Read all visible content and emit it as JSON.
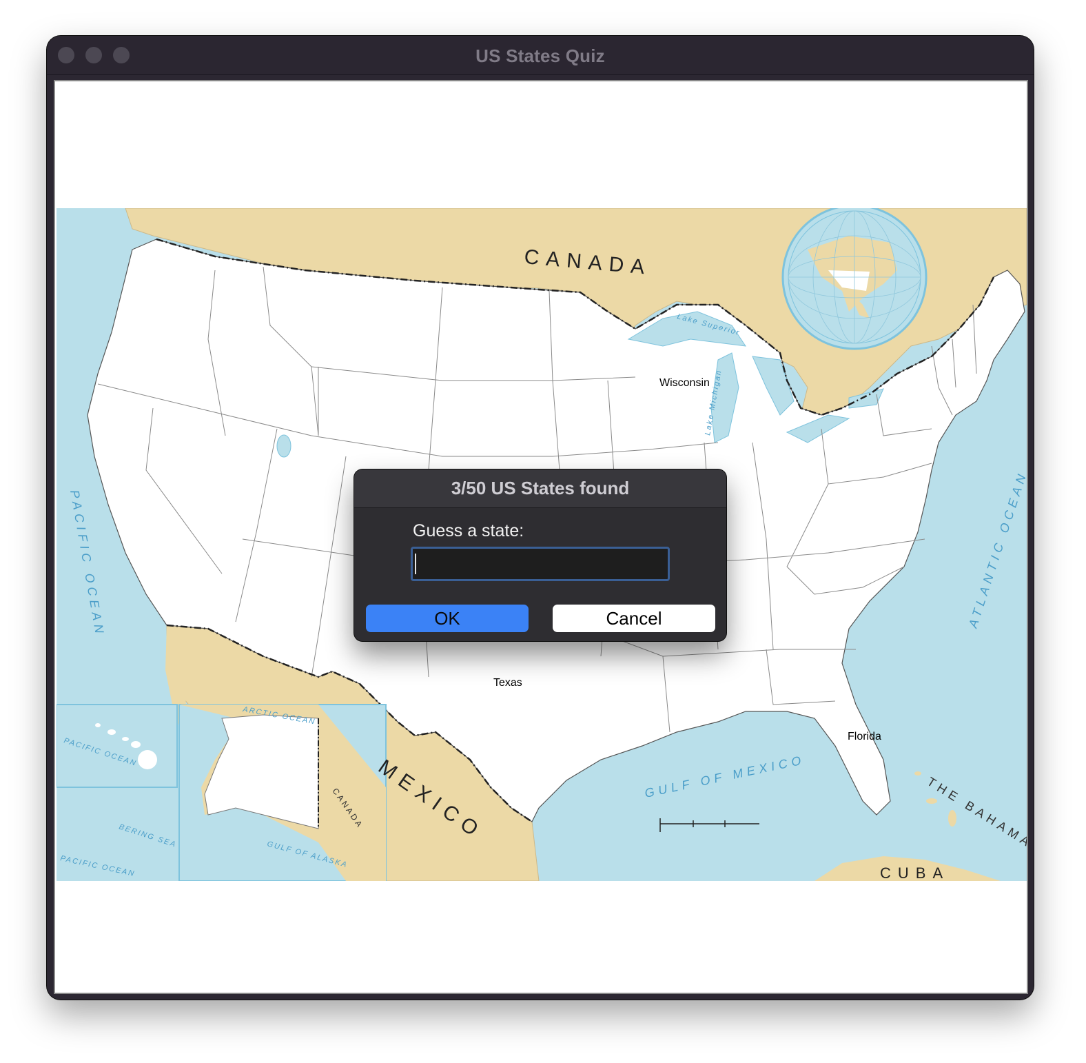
{
  "window": {
    "title": "US States Quiz"
  },
  "map": {
    "labels": {
      "canada": "CANADA",
      "canada_inset": "CANADA",
      "mexico": "MEXICO",
      "pacific": "PACIFIC OCEAN",
      "atlantic": "ATLANTIC OCEAN",
      "gulf": "GULF OF MEXICO",
      "bahamas": "THE BAHAMAS",
      "cuba": "CUBA",
      "arctic": "ARCTIC OCEAN",
      "bering": "BERING SEA",
      "gulf_alaska": "GULF OF ALASKA",
      "pacific_inset": "PACIFIC OCEAN",
      "pacific_alaska": "PACIFIC OCEAN",
      "lake_superior": "Lake Superior",
      "lake_michigan": "Lake Michigan"
    },
    "found_states": [
      "Wisconsin",
      "Texas",
      "Florida"
    ]
  },
  "dialog": {
    "title": "3/50 US States found",
    "prompt": "Guess a state:",
    "input_value": "",
    "ok_label": "OK",
    "cancel_label": "Cancel"
  },
  "colors": {
    "water": "#b9dfea",
    "land_foreign": "#ecd9a6",
    "land_us": "#ffffff",
    "ok_button": "#3b82f6",
    "titlebar": "#2b2631"
  }
}
